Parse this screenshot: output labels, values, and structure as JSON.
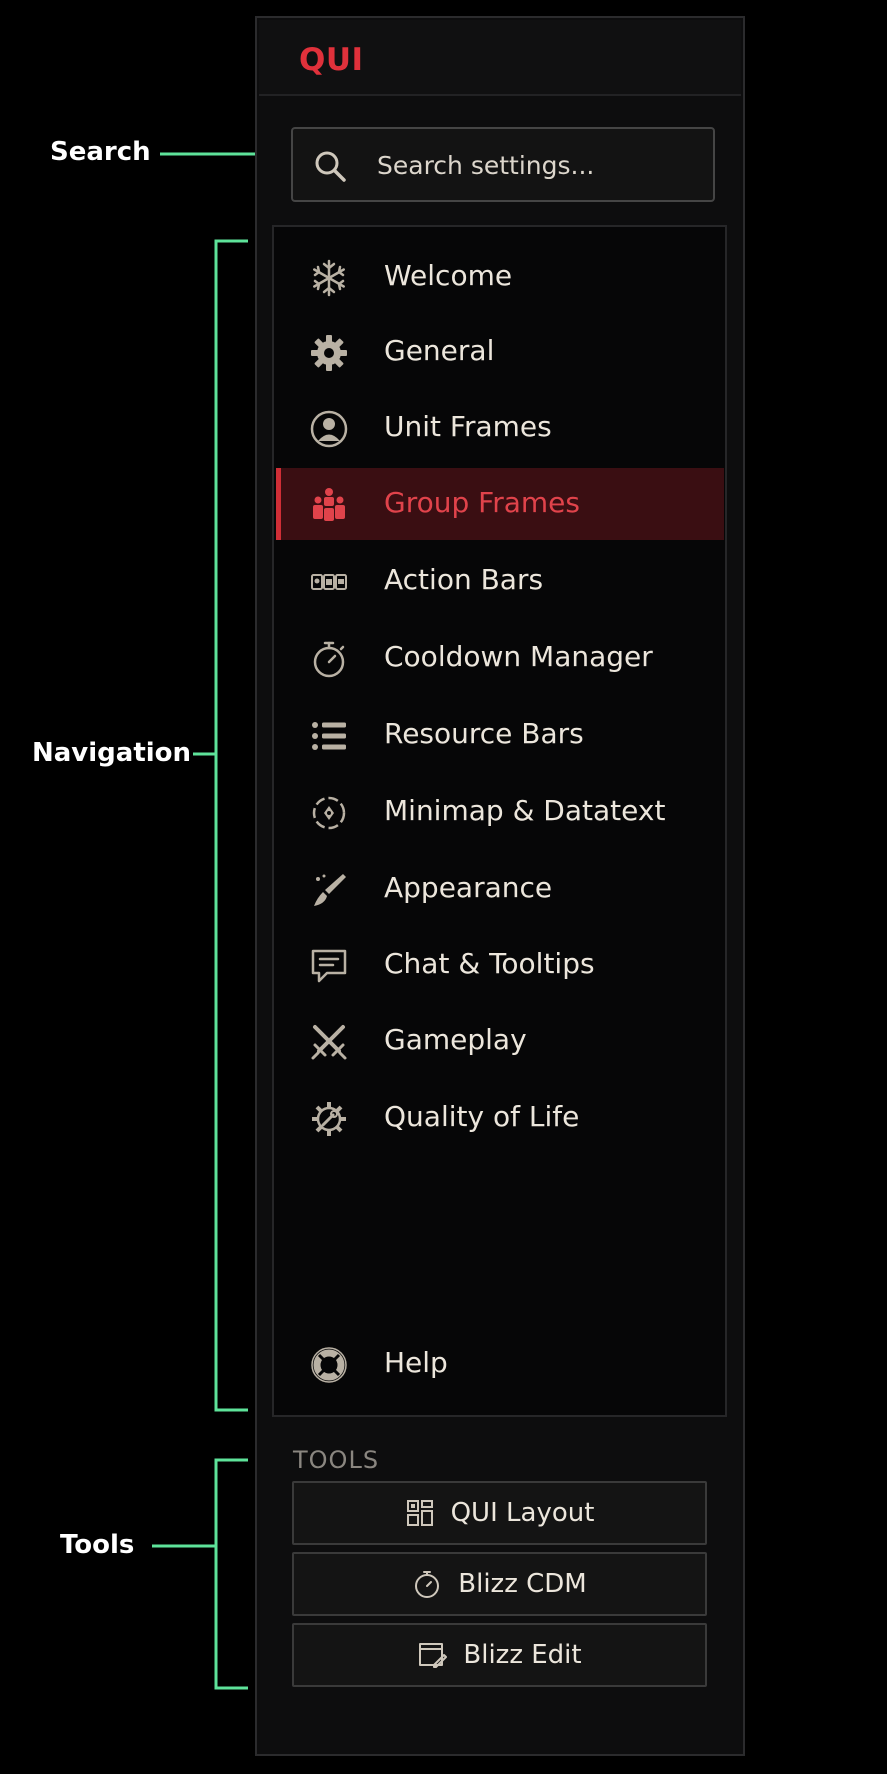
{
  "annotations": {
    "search": "Search",
    "navigation": "Navigation",
    "tools": "Tools",
    "color": "#5ee39a"
  },
  "panel": {
    "title": "QUI",
    "title_color": "#e0313b"
  },
  "search": {
    "placeholder": "Search settings...",
    "value": ""
  },
  "nav": {
    "active_color": "#e0434b",
    "items": [
      {
        "label": "Welcome",
        "icon": "snowflake-icon"
      },
      {
        "label": "General",
        "icon": "gear-icon"
      },
      {
        "label": "Unit Frames",
        "icon": "user-circle-icon"
      },
      {
        "label": "Group Frames",
        "icon": "group-icon",
        "active": true
      },
      {
        "label": "Action Bars",
        "icon": "action-bars-icon"
      },
      {
        "label": "Cooldown Manager",
        "icon": "stopwatch-icon"
      },
      {
        "label": "Resource Bars",
        "icon": "list-icon"
      },
      {
        "label": "Minimap & Datatext",
        "icon": "minimap-icon"
      },
      {
        "label": "Appearance",
        "icon": "paintbrush-icon"
      },
      {
        "label": "Chat & Tooltips",
        "icon": "chat-bubble-icon"
      },
      {
        "label": "Gameplay",
        "icon": "crossed-swords-icon"
      },
      {
        "label": "Quality of Life",
        "icon": "gear-wrench-icon"
      },
      {
        "label": "Help",
        "icon": "lifebuoy-icon"
      }
    ]
  },
  "tools": {
    "heading": "TOOLS",
    "buttons": [
      {
        "label": "QUI Layout",
        "icon": "layout-grid-icon"
      },
      {
        "label": "Blizz CDM",
        "icon": "stopwatch-icon"
      },
      {
        "label": "Blizz Edit",
        "icon": "window-edit-icon"
      }
    ]
  }
}
